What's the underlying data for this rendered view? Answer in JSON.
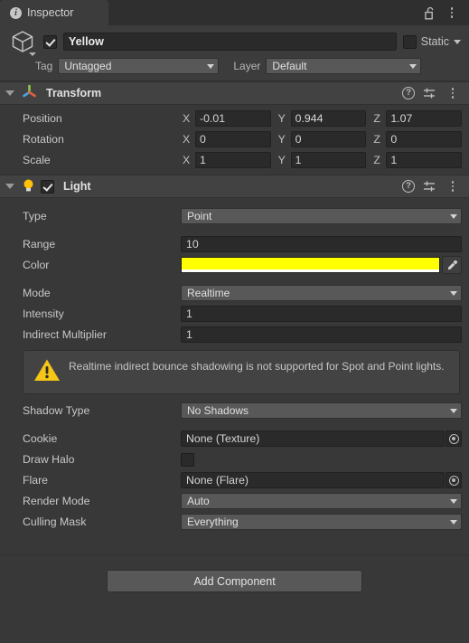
{
  "tab": {
    "label": "Inspector",
    "info_icon": "info-icon",
    "lock_icon": "lock-open-icon",
    "menu_icon": "kebab-menu-icon"
  },
  "gameobject": {
    "icon": "cube-icon",
    "enabled": true,
    "name": "Yellow",
    "static_label": "Static",
    "static_checked": false,
    "tag_label": "Tag",
    "tag_value": "Untagged",
    "layer_label": "Layer",
    "layer_value": "Default"
  },
  "transform": {
    "title": "Transform",
    "icon": "transform-gizmo-icon",
    "help_icon": "help-icon",
    "preset_icon": "preset-settings-icon",
    "menu_icon": "kebab-menu-icon",
    "rows": [
      {
        "label": "Position",
        "x": "-0.01",
        "y": "0.944",
        "z": "1.07"
      },
      {
        "label": "Rotation",
        "x": "0",
        "y": "0",
        "z": "0"
      },
      {
        "label": "Scale",
        "x": "1",
        "y": "1",
        "z": "1"
      }
    ],
    "axis_x": "X",
    "axis_y": "Y",
    "axis_z": "Z"
  },
  "light": {
    "title": "Light",
    "icon": "light-bulb-icon",
    "enabled": true,
    "help_icon": "help-icon",
    "preset_icon": "preset-settings-icon",
    "menu_icon": "kebab-menu-icon",
    "type_label": "Type",
    "type_value": "Point",
    "range_label": "Range",
    "range_value": "10",
    "color_label": "Color",
    "color_value": "#FFFF00",
    "eyedropper_icon": "eyedropper-icon",
    "mode_label": "Mode",
    "mode_value": "Realtime",
    "intensity_label": "Intensity",
    "intensity_value": "1",
    "indirect_label": "Indirect Multiplier",
    "indirect_value": "1",
    "warning_icon": "warning-triangle-icon",
    "warning_text": "Realtime indirect bounce shadowing is not supported for Spot and Point lights.",
    "shadow_label": "Shadow Type",
    "shadow_value": "No Shadows",
    "cookie_label": "Cookie",
    "cookie_value": "None (Texture)",
    "draw_halo_label": "Draw Halo",
    "draw_halo_checked": false,
    "flare_label": "Flare",
    "flare_value": "None (Flare)",
    "render_mode_label": "Render Mode",
    "render_mode_value": "Auto",
    "culling_label": "Culling Mask",
    "culling_value": "Everything"
  },
  "footer": {
    "add_component_label": "Add Component"
  }
}
